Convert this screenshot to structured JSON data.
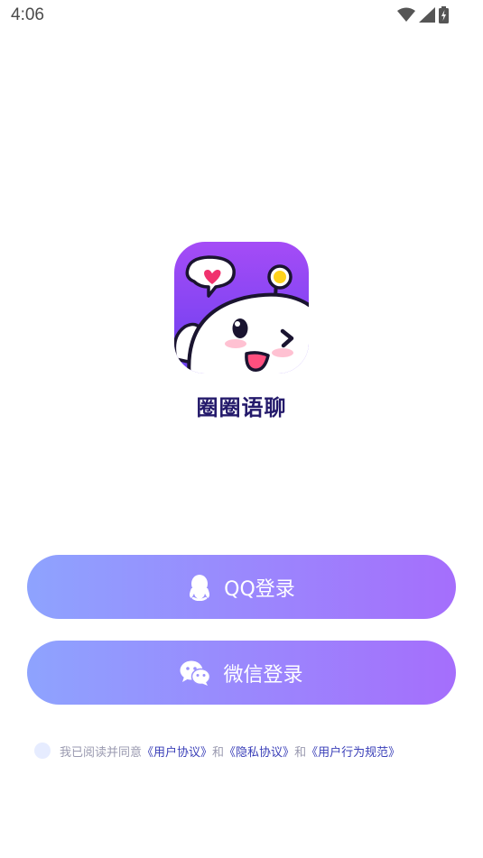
{
  "status_bar": {
    "time": "4:06",
    "icons": [
      "wifi-icon",
      "cell-signal-icon",
      "battery-charging-icon"
    ]
  },
  "app": {
    "name": "圈圈语聊",
    "logo_icon": "mascot-logo-icon",
    "colors": {
      "logo_gradient_top": "#a54cf6",
      "logo_gradient_bottom": "#6a3ff0",
      "title": "#241a6b"
    }
  },
  "buttons": {
    "qq_login": "QQ登录",
    "wechat_login": "微信登录",
    "gradient_start": "#8ea3fe",
    "gradient_end": "#a56efc"
  },
  "agreement": {
    "prefix": "我已阅读并同意",
    "user_agreement": "《用户协议》",
    "and1": "和",
    "privacy_agreement": "《隐私协议》",
    "and2": "和",
    "conduct_rules": "《用户行为规范》"
  }
}
